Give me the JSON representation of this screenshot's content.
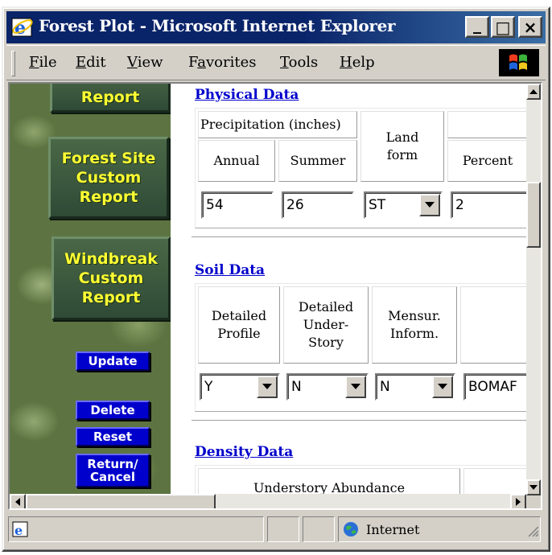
{
  "window": {
    "title": "Forest Plot - Microsoft Internet Explorer"
  },
  "titlebar_buttons": {
    "minimize": "_",
    "maximize": "□",
    "close": "×"
  },
  "menu": [
    "File",
    "Edit",
    "View",
    "Favorites",
    "Tools",
    "Help"
  ],
  "menu_mnemonics": [
    "F",
    "E",
    "V",
    "a",
    "T",
    "H"
  ],
  "sidebar": {
    "partial_report_label": "Report",
    "forest_site_report": "Forest Site\nCustom\nReport",
    "windbreak_report": "Windbreak\nCustom\nReport",
    "update": "Update",
    "delete": "Delete",
    "reset": "Reset",
    "return_cancel": "Return/\nCancel"
  },
  "physical": {
    "heading": "Physical Data",
    "precip_header": "Precipitation (inches)",
    "annual_label": "Annual",
    "summer_label": "Summer",
    "landform_label": "Land\nform",
    "percent_label": "Percent",
    "annual_value": "54",
    "summer_value": "26",
    "landform_value": "ST",
    "percent_value": "2"
  },
  "soil": {
    "heading": "Soil Data",
    "detailed_profile_label": "Detailed\nProfile",
    "detailed_understory_label": "Detailed\nUnder-\nStory",
    "mensur_label": "Mensur.\nInform.",
    "detailed_profile_value": "Y",
    "detailed_understory_value": "N",
    "mensur_value": "N",
    "fourth_value": "BOMAF"
  },
  "density": {
    "heading": "Density Data",
    "understory_label": "Understory Abundance"
  },
  "status": {
    "zone": "Internet"
  }
}
